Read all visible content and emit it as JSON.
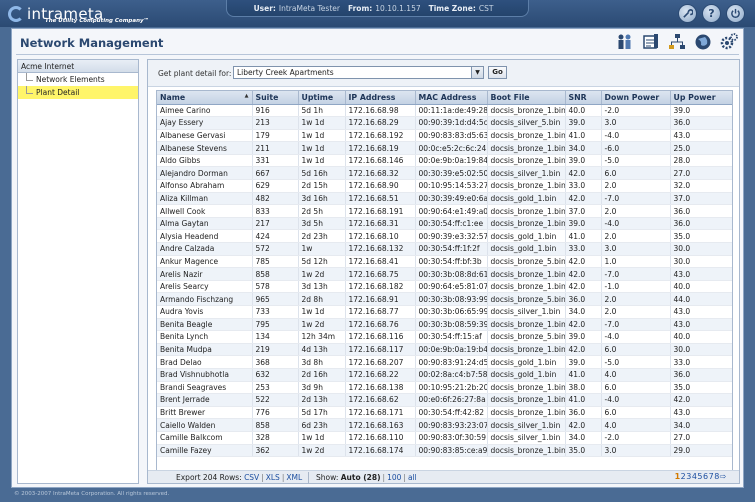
{
  "header": {
    "brand": "intrameta",
    "tagline": "The Utility Computing Company™",
    "user_label": "User:",
    "user": "IntraMeta Tester",
    "from_label": "From:",
    "from": "10.10.1.157",
    "tz_label": "Time Zone:",
    "tz": "CST",
    "icons": [
      "wrench-icon",
      "help-icon",
      "power-icon"
    ]
  },
  "page": {
    "title": "Network Management",
    "app_icons": [
      "users-icon",
      "documents-icon",
      "network-icon",
      "globe-icon",
      "settings-icon"
    ]
  },
  "sidebar": {
    "root": "Acme Internet",
    "items": [
      {
        "label": "Network Elements"
      },
      {
        "label": "Plant Detail"
      }
    ]
  },
  "filter": {
    "label": "Get plant detail for:",
    "selected": "Liberty Creek Apartments",
    "go_label": "Go"
  },
  "table": {
    "columns": [
      "Name",
      "Suite",
      "Uptime",
      "IP Address",
      "MAC Address",
      "Boot File",
      "SNR",
      "Down Power",
      "Up Power"
    ],
    "rows": [
      [
        "Aimee Carino",
        "916",
        "5d 1h",
        "172.16.68.98",
        "00:11:1a:de:49:28",
        "docsis_bronze_1.bin",
        "40.0",
        "-2.0",
        "39.0"
      ],
      [
        "Ajay Essery",
        "213",
        "1w 1d",
        "172.16.68.29",
        "00:90:39:1d:d4:5c",
        "docsis_silver_5.bin",
        "39.0",
        "3.0",
        "36.0"
      ],
      [
        "Albanese Gervasi",
        "179",
        "1w 1d",
        "172.16.68.192",
        "00:90:83:83:d5:63",
        "docsis_bronze_1.bin",
        "41.0",
        "-4.0",
        "43.0"
      ],
      [
        "Albanese Stevens",
        "211",
        "1w 1d",
        "172.16.68.19",
        "00:0c:e5:2c:6c:24",
        "docsis_bronze_1.bin",
        "34.0",
        "-6.0",
        "25.0"
      ],
      [
        "Aldo Gibbs",
        "331",
        "1w 1d",
        "172.16.68.146",
        "00:0e:9b:0a:19:84",
        "docsis_bronze_1.bin",
        "39.0",
        "-5.0",
        "28.0"
      ],
      [
        "Alejandro Dorman",
        "667",
        "5d 16h",
        "172.16.68.32",
        "00:30:39:e5:02:50",
        "docsis_silver_1.bin",
        "42.0",
        "6.0",
        "27.0"
      ],
      [
        "Alfonso Abraham",
        "629",
        "2d 15h",
        "172.16.68.90",
        "00:10:95:14:53:27",
        "docsis_bronze_1.bin",
        "33.0",
        "2.0",
        "32.0"
      ],
      [
        "Aliza Killman",
        "482",
        "3d 16h",
        "172.16.68.51",
        "00:30:39:49:e0:6a",
        "docsis_gold_1.bin",
        "42.0",
        "-7.0",
        "37.0"
      ],
      [
        "Allwell Cook",
        "833",
        "2d 5h",
        "172.16.68.191",
        "00:90:64:e1:49:a0",
        "docsis_bronze_1.bin",
        "37.0",
        "2.0",
        "36.0"
      ],
      [
        "Alma Gaytan",
        "217",
        "3d 5h",
        "172.16.68.31",
        "00:30:54:ff:c1:ee",
        "docsis_bronze_1.bin",
        "39.0",
        "-4.0",
        "36.0"
      ],
      [
        "Alysia Headend",
        "424",
        "2d 23h",
        "172.16.68.10",
        "00:90:39:e3:32:57",
        "docsis_gold_1.bin",
        "41.0",
        "2.0",
        "35.0"
      ],
      [
        "Andre Calzada",
        "572",
        "1w",
        "172.16.68.132",
        "00:30:54:ff:1f:2f",
        "docsis_gold_1.bin",
        "33.0",
        "3.0",
        "30.0"
      ],
      [
        "Ankur Magence",
        "785",
        "5d 12h",
        "172.16.68.41",
        "00:30:54:ff:bf:3b",
        "docsis_bronze_5.bin",
        "42.0",
        "1.0",
        "30.0"
      ],
      [
        "Arelis Nazir",
        "858",
        "1w 2d",
        "172.16.68.75",
        "00:30:3b:08:8d:61",
        "docsis_bronze_1.bin",
        "42.0",
        "-7.0",
        "43.0"
      ],
      [
        "Arelis Searcy",
        "578",
        "3d 13h",
        "172.16.68.182",
        "00:90:64:e5:81:07",
        "docsis_bronze_1.bin",
        "42.0",
        "-1.0",
        "40.0"
      ],
      [
        "Armando Fischzang",
        "965",
        "2d 8h",
        "172.16.68.91",
        "00:30:3b:08:93:99",
        "docsis_bronze_5.bin",
        "36.0",
        "2.0",
        "44.0"
      ],
      [
        "Audra Yovis",
        "733",
        "1w 1d",
        "172.16.68.77",
        "00:30:3b:06:65:99",
        "docsis_silver_1.bin",
        "34.0",
        "2.0",
        "43.0"
      ],
      [
        "Benita Beagle",
        "795",
        "1w 2d",
        "172.16.68.76",
        "00:30:3b:08:59:39",
        "docsis_bronze_1.bin",
        "42.0",
        "-7.0",
        "43.0"
      ],
      [
        "Benita Lynch",
        "134",
        "12h 34m",
        "172.16.68.116",
        "00:30:54:ff:15:af",
        "docsis_bronze_5.bin",
        "39.0",
        "-4.0",
        "40.0"
      ],
      [
        "Benita Mudpa",
        "219",
        "4d 13h",
        "172.16.68.117",
        "00:0e:9b:0a:19:b4",
        "docsis_bronze_1.bin",
        "42.0",
        "6.0",
        "30.0"
      ],
      [
        "Brad Delao",
        "368",
        "3d 8h",
        "172.16.68.207",
        "00:90:83:91:24:d5",
        "docsis_gold_1.bin",
        "39.0",
        "-5.0",
        "33.0"
      ],
      [
        "Brad Vishnubhotla",
        "632",
        "2d 16h",
        "172.16.68.22",
        "00:02:8a:c4:b7:58",
        "docsis_gold_1.bin",
        "41.0",
        "4.0",
        "36.0"
      ],
      [
        "Brandi Seagraves",
        "253",
        "3d 9h",
        "172.16.68.138",
        "00:10:95:21:2b:20",
        "docsis_bronze_1.bin",
        "38.0",
        "6.0",
        "35.0"
      ],
      [
        "Brent Jerrade",
        "522",
        "2d 13h",
        "172.16.68.62",
        "00:e0:6f:26:27:8a",
        "docsis_bronze_1.bin",
        "41.0",
        "-4.0",
        "42.0"
      ],
      [
        "Britt Brewer",
        "776",
        "5d 17h",
        "172.16.68.171",
        "00:30:54:ff:42:82",
        "docsis_bronze_1.bin",
        "36.0",
        "6.0",
        "43.0"
      ],
      [
        "Caiello Walden",
        "858",
        "6d 23h",
        "172.16.68.163",
        "00:90:83:93:23:07",
        "docsis_silver_1.bin",
        "42.0",
        "4.0",
        "34.0"
      ],
      [
        "Camille Balkcom",
        "328",
        "1w 1d",
        "172.16.68.110",
        "00:90:83:0f:30:59",
        "docsis_silver_1.bin",
        "34.0",
        "-2.0",
        "27.0"
      ],
      [
        "Camille Fazey",
        "362",
        "1w 2d",
        "172.16.68.174",
        "00:90:83:85:ce:a9",
        "docsis_bronze_1.bin",
        "35.0",
        "3.0",
        "29.0"
      ]
    ]
  },
  "footer": {
    "export_label": "Export 204 Rows:",
    "csv": "CSV",
    "xls": "XLS",
    "xml": "XML",
    "show_label": "Show:",
    "auto": "Auto (28)",
    "hundred": "100",
    "all": "all",
    "pages": [
      "1",
      "2",
      "3",
      "4",
      "5",
      "6",
      "7",
      "8"
    ],
    "next": "⇨"
  },
  "copyright": "© 2003-2007 IntraMeta Corporation.  All rights reserved."
}
